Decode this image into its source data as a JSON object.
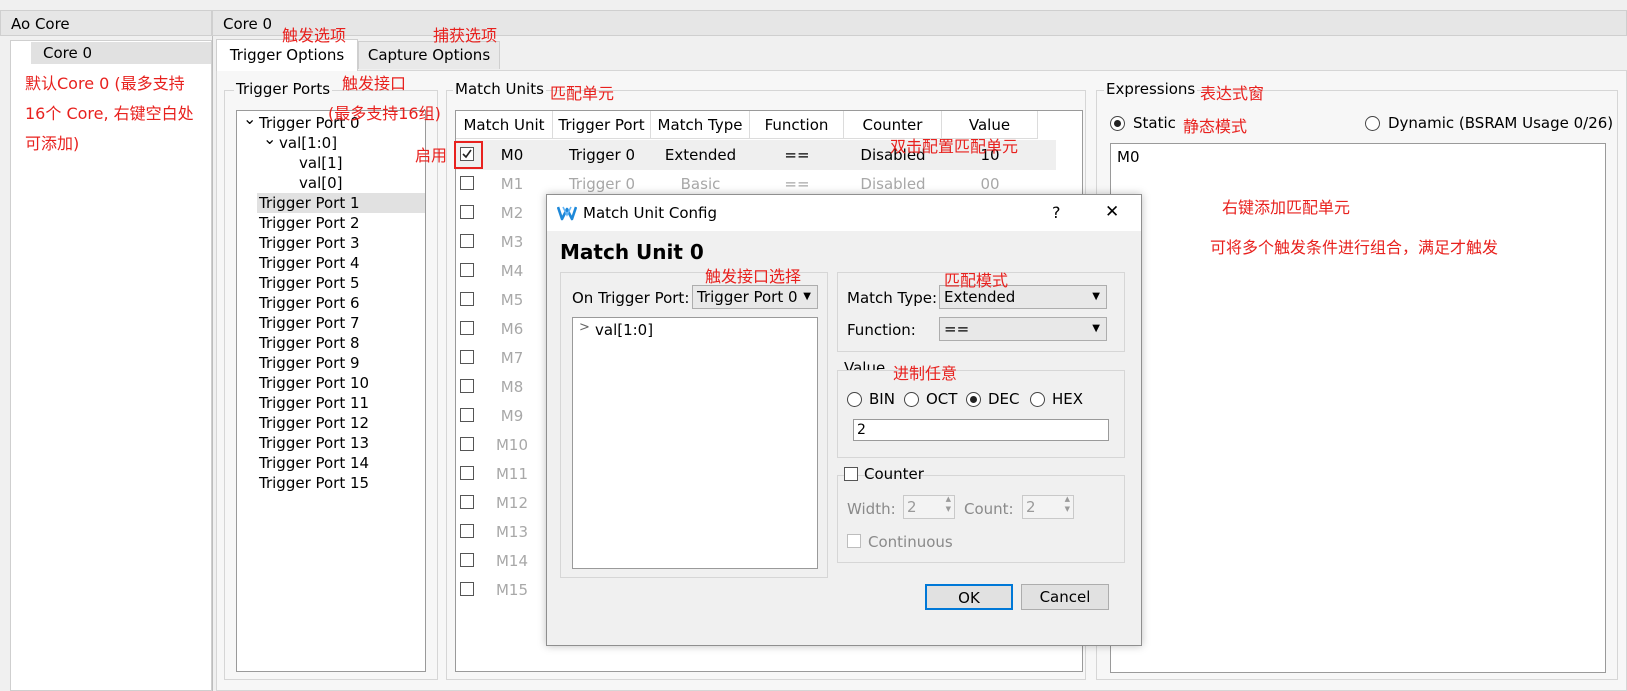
{
  "left_header": {
    "title": "Ao Core"
  },
  "right_header": {
    "title": "Core 0"
  },
  "cores": [
    {
      "label": "Core 0"
    }
  ],
  "tabs": [
    {
      "label": "Trigger Options",
      "active": true
    },
    {
      "label": "Capture Options",
      "active": false
    }
  ],
  "trigger_ports": {
    "title": "Trigger Ports",
    "items": [
      {
        "label": "Trigger Port 0",
        "level": 0,
        "expanded": true
      },
      {
        "label": "val[1:0]",
        "level": 1,
        "expanded": true
      },
      {
        "label": "val[1]",
        "level": 2
      },
      {
        "label": "val[0]",
        "level": 2
      },
      {
        "label": "Trigger Port 1",
        "level": 0,
        "selected": true
      },
      {
        "label": "Trigger Port 2",
        "level": 0
      },
      {
        "label": "Trigger Port 3",
        "level": 0
      },
      {
        "label": "Trigger Port 4",
        "level": 0
      },
      {
        "label": "Trigger Port 5",
        "level": 0
      },
      {
        "label": "Trigger Port 6",
        "level": 0
      },
      {
        "label": "Trigger Port 7",
        "level": 0
      },
      {
        "label": "Trigger Port 8",
        "level": 0
      },
      {
        "label": "Trigger Port 9",
        "level": 0
      },
      {
        "label": "Trigger Port 10",
        "level": 0
      },
      {
        "label": "Trigger Port 11",
        "level": 0
      },
      {
        "label": "Trigger Port 12",
        "level": 0
      },
      {
        "label": "Trigger Port 13",
        "level": 0
      },
      {
        "label": "Trigger Port 14",
        "level": 0
      },
      {
        "label": "Trigger Port 15",
        "level": 0
      }
    ]
  },
  "match_units": {
    "title": "Match Units",
    "columns": [
      "Match Unit",
      "Trigger Port",
      "Match Type",
      "Function",
      "Counter",
      "Value"
    ],
    "rows": [
      {
        "checked": true,
        "name": "M0",
        "trigger_port": "Trigger 0",
        "match_type": "Extended",
        "function": "==",
        "counter": "Disabled",
        "value": "10"
      },
      {
        "checked": false,
        "name": "M1",
        "trigger_port": "Trigger 0",
        "match_type": "Basic",
        "function": "==",
        "counter": "Disabled",
        "value": "00"
      },
      {
        "checked": false,
        "name": "M2"
      },
      {
        "checked": false,
        "name": "M3"
      },
      {
        "checked": false,
        "name": "M4"
      },
      {
        "checked": false,
        "name": "M5"
      },
      {
        "checked": false,
        "name": "M6"
      },
      {
        "checked": false,
        "name": "M7"
      },
      {
        "checked": false,
        "name": "M8"
      },
      {
        "checked": false,
        "name": "M9"
      },
      {
        "checked": false,
        "name": "M10"
      },
      {
        "checked": false,
        "name": "M11"
      },
      {
        "checked": false,
        "name": "M12"
      },
      {
        "checked": false,
        "name": "M13"
      },
      {
        "checked": false,
        "name": "M14"
      },
      {
        "checked": false,
        "name": "M15"
      }
    ]
  },
  "expressions": {
    "title": "Expressions",
    "static_label": "Static",
    "static_selected": true,
    "dynamic_label": "Dynamic (BSRAM Usage 0/26)",
    "dynamic_selected": false,
    "content": "M0"
  },
  "dialog": {
    "title": "Match Unit Config",
    "help": "?",
    "close": "✕",
    "heading": "Match Unit 0",
    "on_trigger_port_label": "On Trigger Port:",
    "on_trigger_port_value": "Trigger Port 0",
    "tree_item": "val[1:0]",
    "match_type_label": "Match Type:",
    "match_type_value": "Extended",
    "function_label": "Function:",
    "function_value": "==",
    "value_title": "Value",
    "radix": [
      {
        "label": "BIN",
        "selected": false
      },
      {
        "label": "OCT",
        "selected": false
      },
      {
        "label": "DEC",
        "selected": true
      },
      {
        "label": "HEX",
        "selected": false
      }
    ],
    "value": "2",
    "counter_label": "Counter",
    "counter_checked": false,
    "width_label": "Width:",
    "width_value": "2",
    "count_label": "Count:",
    "count_value": "2",
    "continuous_label": "Continuous",
    "ok": "OK",
    "cancel": "Cancel"
  },
  "annotations": {
    "trigger_options": "触发选项",
    "capture_options": "捕获选项",
    "default_core": [
      "默认Core 0 (最多支持",
      "16个 Core, 右键空白处",
      "可添加)"
    ],
    "trigger_port": "触发接口",
    "max_ports": "(最多支持16组)",
    "match_units": "匹配单元",
    "enable": "启用",
    "double_click": "双击配置匹配单元",
    "expressions_window": "表达式窗",
    "static_mode": "静态模式",
    "right_click_add": "右键添加匹配单元",
    "combine": "可将多个触发条件进行组合，满足才触发",
    "port_select": "触发接口选择",
    "match_mode": "匹配模式",
    "any_radix": "进制任意"
  },
  "colors": {
    "annotation": "#e8211e",
    "dialog_accent": "#0078d7"
  }
}
